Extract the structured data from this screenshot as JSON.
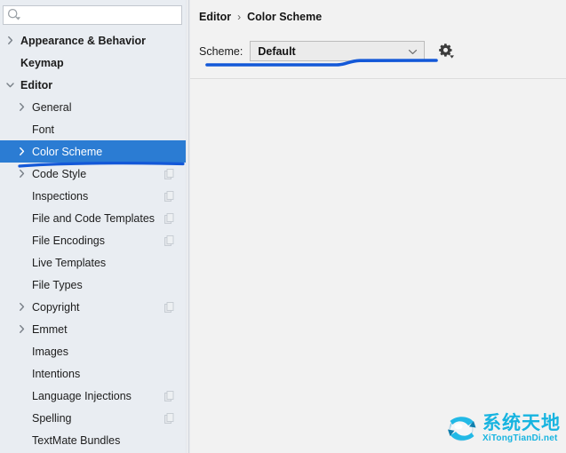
{
  "colors": {
    "selection_blue": "#2b7cd3",
    "annotation_blue": "#1358d8",
    "sidebar_bg": "#e9edf2",
    "content_bg": "#f2f2f2",
    "watermark_cyan": "#17b4e0"
  },
  "search": {
    "value": "",
    "placeholder": "",
    "icon": "search-icon"
  },
  "sidebar": {
    "items": [
      {
        "label": "Appearance & Behavior",
        "depth": 0,
        "arrow": "chevron-right",
        "selected": false,
        "badge": false
      },
      {
        "label": "Keymap",
        "depth": 0,
        "arrow": "none",
        "selected": false,
        "badge": false
      },
      {
        "label": "Editor",
        "depth": 0,
        "arrow": "chevron-down",
        "selected": false,
        "badge": false
      },
      {
        "label": "General",
        "depth": 1,
        "arrow": "chevron-right",
        "selected": false,
        "badge": false
      },
      {
        "label": "Font",
        "depth": 1,
        "arrow": "none",
        "selected": false,
        "badge": false
      },
      {
        "label": "Color Scheme",
        "depth": 1,
        "arrow": "chevron-right",
        "selected": true,
        "badge": false
      },
      {
        "label": "Code Style",
        "depth": 1,
        "arrow": "chevron-right",
        "selected": false,
        "badge": true
      },
      {
        "label": "Inspections",
        "depth": 1,
        "arrow": "none",
        "selected": false,
        "badge": true
      },
      {
        "label": "File and Code Templates",
        "depth": 1,
        "arrow": "none",
        "selected": false,
        "badge": true
      },
      {
        "label": "File Encodings",
        "depth": 1,
        "arrow": "none",
        "selected": false,
        "badge": true
      },
      {
        "label": "Live Templates",
        "depth": 1,
        "arrow": "none",
        "selected": false,
        "badge": false
      },
      {
        "label": "File Types",
        "depth": 1,
        "arrow": "none",
        "selected": false,
        "badge": false
      },
      {
        "label": "Copyright",
        "depth": 1,
        "arrow": "chevron-right",
        "selected": false,
        "badge": true
      },
      {
        "label": "Emmet",
        "depth": 1,
        "arrow": "chevron-right",
        "selected": false,
        "badge": false
      },
      {
        "label": "Images",
        "depth": 1,
        "arrow": "none",
        "selected": false,
        "badge": false
      },
      {
        "label": "Intentions",
        "depth": 1,
        "arrow": "none",
        "selected": false,
        "badge": false
      },
      {
        "label": "Language Injections",
        "depth": 1,
        "arrow": "none",
        "selected": false,
        "badge": true
      },
      {
        "label": "Spelling",
        "depth": 1,
        "arrow": "none",
        "selected": false,
        "badge": true
      },
      {
        "label": "TextMate Bundles",
        "depth": 1,
        "arrow": "none",
        "selected": false,
        "badge": false
      }
    ]
  },
  "content": {
    "breadcrumb": {
      "parent": "Editor",
      "separator": "›",
      "current": "Color Scheme"
    },
    "scheme": {
      "label": "Scheme:",
      "value": "Default",
      "options": [
        "Default"
      ],
      "chevron_icon": "chevron-down-icon",
      "gear_icon": "gear-icon"
    }
  },
  "watermark": {
    "cn": "系统天地",
    "en": "XiTongTianDi.net",
    "icon": "globe-icon"
  }
}
